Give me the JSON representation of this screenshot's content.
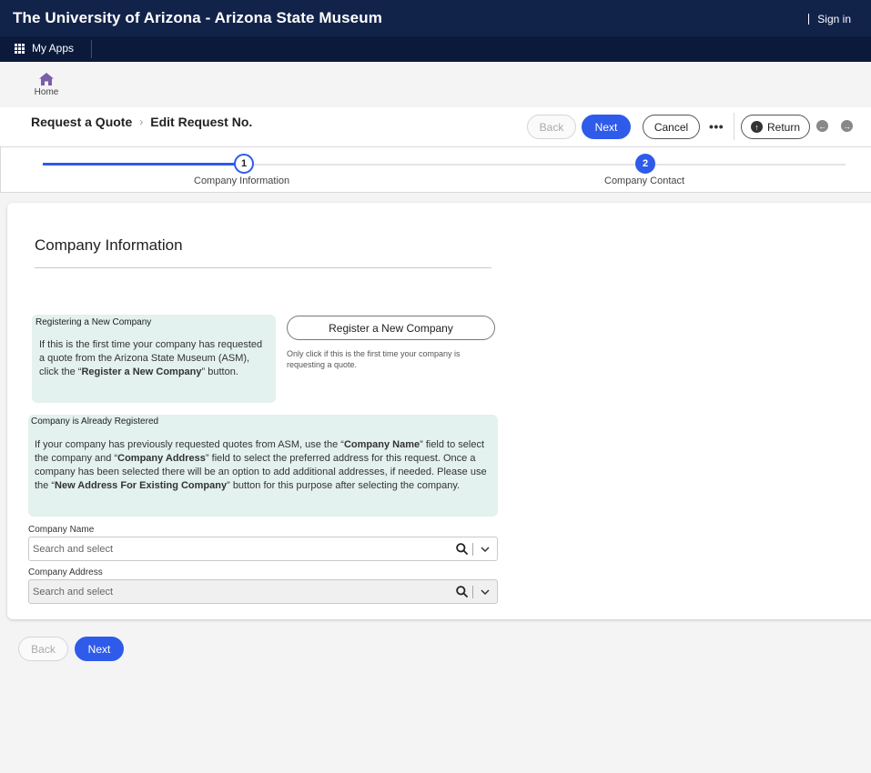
{
  "header": {
    "title": "The University of Arizona - Arizona State Museum",
    "sign_in": "Sign in",
    "my_apps": "My Apps"
  },
  "home": {
    "label": "Home"
  },
  "breadcrumb": {
    "items": [
      "Request a Quote",
      "Edit Request No."
    ],
    "separator": "›"
  },
  "toolbar": {
    "back": "Back",
    "next": "Next",
    "cancel": "Cancel",
    "more": "•••",
    "return": "Return"
  },
  "stepper": {
    "steps": [
      {
        "number": "1",
        "label": "Company Information",
        "state": "current"
      },
      {
        "number": "2",
        "label": "Company Contact",
        "state": "upcoming"
      }
    ]
  },
  "form": {
    "title": "Company Information",
    "new_company_box": {
      "heading": "Registering a New Company",
      "text_before": "If this is the first time your company has requested a quote from the Arizona State Museum (ASM), click the “",
      "bold": "Register a New Company",
      "text_after": "” button."
    },
    "register_button": "Register a New Company",
    "register_note": "Only click if this is the first time your company is requesting a quote.",
    "registered_box": {
      "heading": "Company is Already Registered",
      "t1": "If your company has previously requested quotes from ASM, use the “",
      "b1": "Company Name",
      "t2": "” field to select the company and “",
      "b2": "Company Address",
      "t3": "” field to select the preferred address for this request. Once a company has been selected there will be an option to add additional addresses, if needed. Please use the “",
      "b3": "New Address For Existing Company",
      "t4": "” button for this purpose after selecting the company."
    },
    "company_name": {
      "label": "Company Name",
      "placeholder": "Search and select"
    },
    "company_address": {
      "label": "Company Address",
      "placeholder": "Search and select"
    }
  },
  "footer": {
    "back": "Back",
    "next": "Next"
  },
  "colors": {
    "header_bg": "#12234a",
    "accent": "#2f5bea",
    "info_bg": "#e3f1ef",
    "home_icon": "#7b5ea7"
  }
}
